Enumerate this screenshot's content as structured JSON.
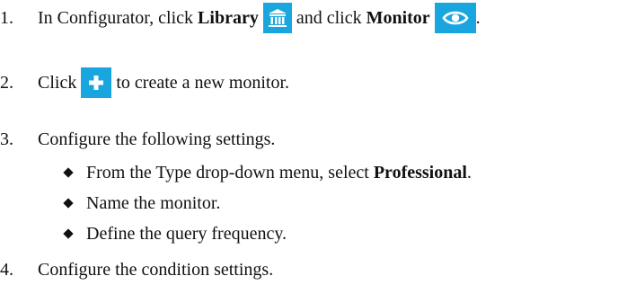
{
  "steps": [
    {
      "number": "1.",
      "parts": {
        "t1": "In Configurator, click",
        "b1": "Library",
        "t2": "and click",
        "b2": "Monitor",
        "t3": "."
      }
    },
    {
      "number": "2.",
      "parts": {
        "t1": "Click",
        "t2": "to create a new monitor."
      }
    },
    {
      "number": "3.",
      "text": "Configure the following settings.",
      "bullets": [
        {
          "t1": "From the Type drop-down menu, select",
          "b1": "Professional",
          "t2": "."
        },
        {
          "t1": "Name the monitor."
        },
        {
          "t1": "Define the query frequency."
        }
      ]
    },
    {
      "number": "4.",
      "text": "Configure the condition settings."
    }
  ],
  "icons": {
    "library": "library-icon",
    "monitor": "eye-icon",
    "add": "plus-icon"
  },
  "colors": {
    "icon_background": "#19a6df",
    "icon_foreground": "#ffffff",
    "text": "#111111"
  }
}
